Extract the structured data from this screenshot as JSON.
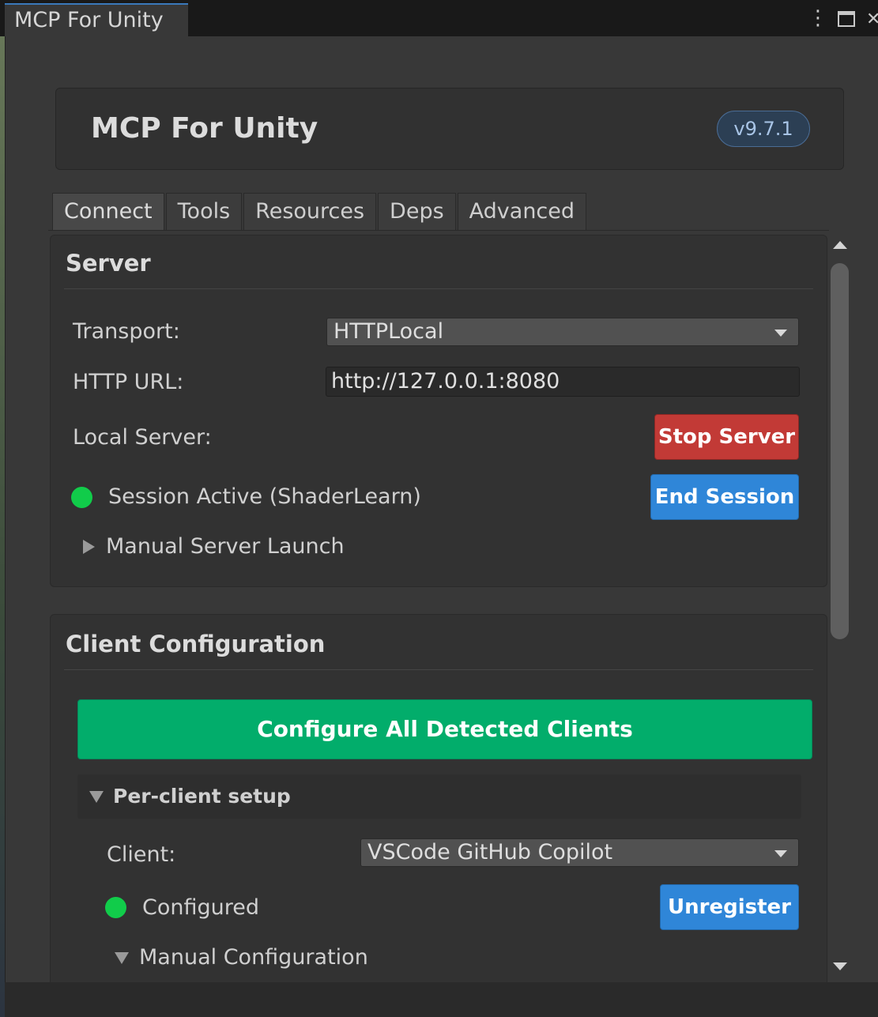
{
  "window": {
    "tab_title": "MCP For Unity",
    "menu_icon": "kebab-menu-icon",
    "maximize_icon": "maximize-icon",
    "close_icon": "close-icon",
    "close_glyph": "✕"
  },
  "header": {
    "title": "MCP For Unity",
    "version": "v9.7.1"
  },
  "tabs": [
    {
      "label": "Connect",
      "active": true
    },
    {
      "label": "Tools",
      "active": false
    },
    {
      "label": "Resources",
      "active": false
    },
    {
      "label": "Deps",
      "active": false
    },
    {
      "label": "Advanced",
      "active": false
    }
  ],
  "server": {
    "title": "Server",
    "transport_label": "Transport:",
    "transport_value": "HTTPLocal",
    "http_url_label": "HTTP URL:",
    "http_url_value": "http://127.0.0.1:8080",
    "local_server_label": "Local Server:",
    "stop_server_label": "Stop Server",
    "session_status": "Session Active (ShaderLearn)",
    "end_session_label": "End Session",
    "manual_launch_label": "Manual Server Launch"
  },
  "client_config": {
    "title": "Client Configuration",
    "configure_all_label": "Configure All Detected Clients",
    "per_client_label": "Per-client setup",
    "client_label": "Client:",
    "client_value": "VSCode GitHub Copilot",
    "status": "Configured",
    "unregister_label": "Unregister",
    "manual_config_label": "Manual Configuration"
  },
  "colors": {
    "accent_blue": "#2f86d8",
    "stop_red": "#c23a36",
    "configure_green": "#02ad6b",
    "status_green": "#11cc4a"
  }
}
